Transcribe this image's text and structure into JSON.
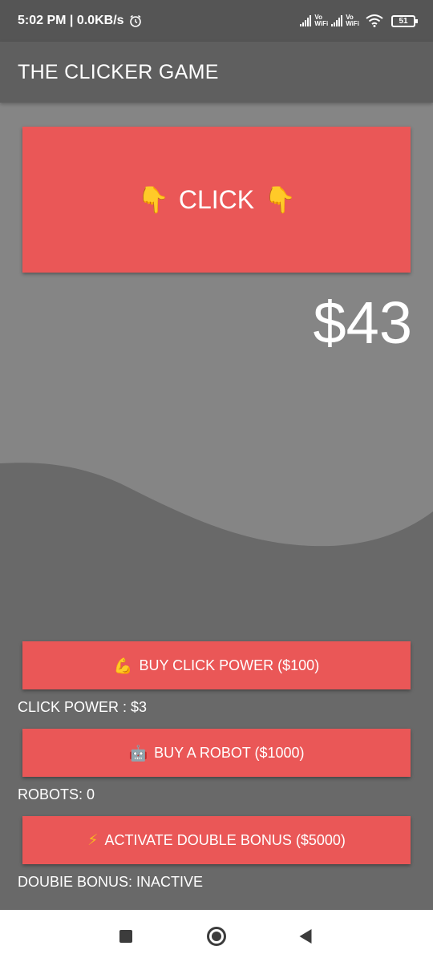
{
  "status_bar": {
    "time_net": "5:02 PM | 0.0KB/s",
    "vowifi_1": [
      "Vo",
      "WiFi"
    ],
    "vowifi_2": [
      "Vo",
      "WiFi"
    ],
    "battery": "51"
  },
  "app_bar": {
    "title": "THE CLICKER GAME"
  },
  "click_button": {
    "label": "CLICK",
    "emoji_left": "👇",
    "emoji_right": "👇"
  },
  "money": "$43",
  "shop": {
    "buy_click_power": {
      "emoji": "💪",
      "label": "BUY CLICK POWER ($100)"
    },
    "click_power_info": "CLICK POWER : $3",
    "buy_robot": {
      "emoji": "🤖",
      "label": "BUY A ROBOT ($1000)"
    },
    "robots_info": "ROBOTS: 0",
    "double_bonus": {
      "emoji": "⚡",
      "label": "ACTIVATE DOUBLE BONUS ($5000)"
    },
    "double_bonus_info": "DOUBIE BONUS: INACTIVE"
  },
  "colors": {
    "accent": "#ea5757",
    "background_dark": "#696969",
    "background_light": "#858585",
    "app_bar": "#5f5f5f"
  },
  "icons": {
    "alarm": "alarm-icon",
    "signal": "signal-icon",
    "wifi": "wifi-icon",
    "battery": "battery-icon",
    "recents": "recents-square-icon",
    "home": "home-circle-icon",
    "back": "back-triangle-icon"
  }
}
